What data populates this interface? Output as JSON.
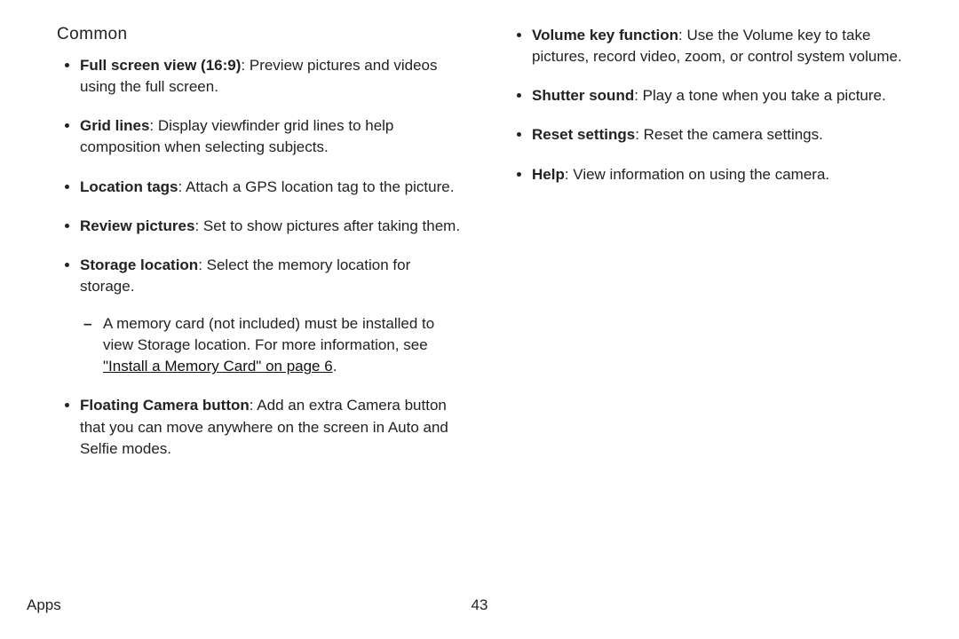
{
  "heading": "Common",
  "col1": {
    "items": [
      {
        "title": "Full screen view (16:9)",
        "desc": ": Preview pictures and videos using the full screen."
      },
      {
        "title": "Grid lines",
        "desc": ": Display viewfinder grid lines to help composition when selecting subjects."
      },
      {
        "title": "Location tags",
        "desc": ": Attach a GPS location tag to the picture."
      },
      {
        "title": "Review pictures",
        "desc": ": Set to show pictures after taking them."
      },
      {
        "title": "Storage location",
        "desc": ": Select the memory location for storage.",
        "sub": {
          "pre": "A memory card (not included) must be installed to view Storage location. For more information, see ",
          "link": "\"Install a Memory Card\" on page 6",
          "post": "."
        }
      },
      {
        "title": "Floating Camera button",
        "desc": ": Add an extra Camera button that you can move anywhere on the screen in Auto and Selfie modes."
      }
    ]
  },
  "col2": {
    "items": [
      {
        "title": "Volume key function",
        "desc": ": Use the Volume key to take pictures, record video, zoom, or control system volume."
      },
      {
        "title": "Shutter sound",
        "desc": ": Play a tone when you take a picture."
      },
      {
        "title": "Reset settings",
        "desc": ": Reset the camera settings."
      },
      {
        "title": "Help",
        "desc": ": View information on using the camera."
      }
    ]
  },
  "footer": {
    "section": "Apps",
    "page": "43"
  }
}
